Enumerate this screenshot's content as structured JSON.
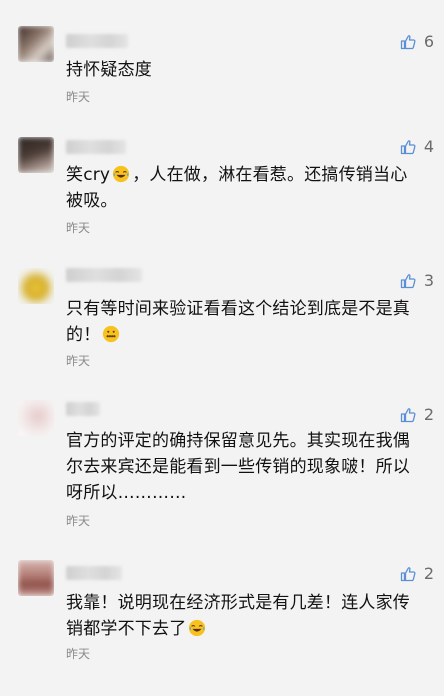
{
  "comments": [
    {
      "likes": "6",
      "text": "持怀疑态度",
      "time": "昨天"
    },
    {
      "likes": "4",
      "text_before_emoji": "笑cry",
      "emoji": "laughing-tears-emoji",
      "text_after_emoji": "，人在做，淋在看惹。还搞传销当心被吸。",
      "time": "昨天"
    },
    {
      "likes": "3",
      "text": "只有等时间来验证看看这个结论到底是不是真的！",
      "emoji": "zipper-mouth-emoji",
      "time": "昨天"
    },
    {
      "likes": "2",
      "text": "官方的评定的确持保留意见先。其实现在我偶尔去来宾还是能看到一些传销的现象啵！所以呀所以…………",
      "time": "昨天"
    },
    {
      "likes": "2",
      "text": "我靠！说明现在经济形式是有几差！连人家传销都学不下去了",
      "emoji": "laughing-tears-emoji",
      "time": "昨天"
    }
  ],
  "colors": {
    "background": "#f3f3f3",
    "text": "#111111",
    "muted": "#8a8a8a",
    "like_icon": "#5a8fd6"
  }
}
